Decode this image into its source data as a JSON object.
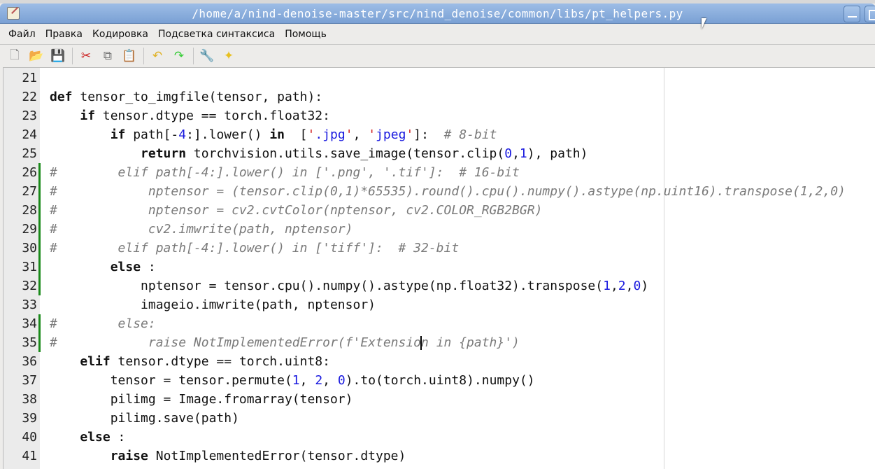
{
  "window": {
    "title": "/home/a/nind-denoise-master/src/nind_denoise/common/libs/pt_helpers.py"
  },
  "menu": [
    "Файл",
    "Правка",
    "Кодировка",
    "Подсветка синтаксиса",
    "Помощь"
  ],
  "toolbar": [
    {
      "name": "new-file",
      "glyph": "🗋"
    },
    {
      "name": "open-file",
      "glyph": "📂"
    },
    {
      "name": "save-file",
      "glyph": "💾"
    },
    {
      "sep": true
    },
    {
      "name": "cut",
      "glyph": "✂"
    },
    {
      "name": "copy",
      "glyph": "⧉"
    },
    {
      "name": "paste",
      "glyph": "📋"
    },
    {
      "sep": true
    },
    {
      "name": "undo",
      "glyph": "↶"
    },
    {
      "name": "redo",
      "glyph": "↷"
    },
    {
      "sep": true
    },
    {
      "name": "preferences",
      "glyph": "🔧"
    },
    {
      "name": "highlight",
      "glyph": "✦"
    }
  ],
  "editor": {
    "first_line": 21,
    "changed_lines": [
      26,
      27,
      28,
      29,
      30,
      31,
      32,
      34,
      35
    ],
    "cursor": {
      "line": 35,
      "col": 42
    },
    "lines": [
      [],
      [
        [
          "kw",
          "def"
        ],
        [
          "",
          "tensor_to_imgfile(tensor, path):"
        ]
      ],
      [
        [
          "",
          "    "
        ],
        [
          "kw",
          "if"
        ],
        [
          "",
          "tensor.dtype == torch.float32:"
        ]
      ],
      [
        [
          "",
          "        "
        ],
        [
          "kw",
          "if"
        ],
        [
          "",
          "path[-"
        ],
        [
          "num",
          "4"
        ],
        [
          "",
          ":].lower() "
        ],
        [
          "kw",
          "in"
        ],
        [
          "",
          " ["
        ],
        [
          "q",
          "'"
        ],
        [
          "str",
          ".jpg"
        ],
        [
          "q",
          "'"
        ],
        [
          "",
          ", "
        ],
        [
          "q",
          "'"
        ],
        [
          "str",
          "jpeg"
        ],
        [
          "q",
          "'"
        ],
        [
          "",
          "]:  "
        ],
        [
          "cm",
          "# 8-bit"
        ]
      ],
      [
        [
          "",
          "            "
        ],
        [
          "kw",
          "return"
        ],
        [
          "",
          "torchvision.utils.save_image(tensor.clip("
        ],
        [
          "num",
          "0"
        ],
        [
          "",
          ","
        ],
        [
          "num",
          "1"
        ],
        [
          "",
          "), path)"
        ]
      ],
      [
        [
          "cm",
          "#        elif path[-4:].lower() in ['.png', '.tif']:  # 16-bit"
        ]
      ],
      [
        [
          "cm",
          "#            nptensor = (tensor.clip(0,1)*65535).round().cpu().numpy().astype(np.uint16).transpose(1,2,0)"
        ]
      ],
      [
        [
          "cm",
          "#            nptensor = cv2.cvtColor(nptensor, cv2.COLOR_RGB2BGR)"
        ]
      ],
      [
        [
          "cm",
          "#            cv2.imwrite(path, nptensor)"
        ]
      ],
      [
        [
          "cm",
          "#        elif path[-4:].lower() in ['tiff']:  # 32-bit"
        ]
      ],
      [
        [
          "",
          "        "
        ],
        [
          "kw",
          "else"
        ],
        [
          "",
          ":"
        ]
      ],
      [
        [
          "",
          "            nptensor = tensor.cpu().numpy().astype(np.float32).transpose("
        ],
        [
          "num",
          "1"
        ],
        [
          "",
          ","
        ],
        [
          "num",
          "2"
        ],
        [
          "",
          ","
        ],
        [
          "num",
          "0"
        ],
        [
          "",
          ")"
        ]
      ],
      [
        [
          "",
          "            imageio.imwrite(path, nptensor)"
        ]
      ],
      [
        [
          "cm",
          "#        else:"
        ]
      ],
      [
        [
          "cm",
          "#            raise NotImplementedError(f'Extensio"
        ],
        [
          "cursor",
          ""
        ],
        [
          "cm",
          "n in {path}')"
        ]
      ],
      [
        [
          "",
          "    "
        ],
        [
          "kw",
          "elif"
        ],
        [
          "",
          "tensor.dtype == torch.uint8:"
        ]
      ],
      [
        [
          "",
          "        tensor = tensor.permute("
        ],
        [
          "num",
          "1"
        ],
        [
          "",
          ", "
        ],
        [
          "num",
          "2"
        ],
        [
          "",
          ", "
        ],
        [
          "num",
          "0"
        ],
        [
          "",
          ").to(torch.uint8).numpy()"
        ]
      ],
      [
        [
          "",
          "        pilimg = Image.fromarray(tensor)"
        ]
      ],
      [
        [
          "",
          "        pilimg.save(path)"
        ]
      ],
      [
        [
          "",
          "    "
        ],
        [
          "kw",
          "else"
        ],
        [
          "",
          ":"
        ]
      ],
      [
        [
          "",
          "        "
        ],
        [
          "kw",
          "raise"
        ],
        [
          "",
          "NotImplementedError(tensor.dtype)"
        ]
      ]
    ]
  }
}
